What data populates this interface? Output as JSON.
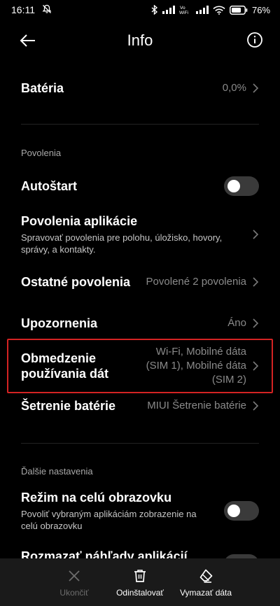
{
  "status_bar": {
    "time": "16:11",
    "battery": "76",
    "network_label": "Vo WiFi"
  },
  "header": {
    "title": "Info"
  },
  "battery_row": {
    "label": "Batéria",
    "value": "0,0%"
  },
  "permissions_section": {
    "title": "Povolenia",
    "autostart": {
      "label": "Autoštart",
      "enabled": false
    },
    "app_permissions": {
      "label": "Povolenia aplikácie",
      "description": "Spravovať povolenia pre polohu, úložisko, hovory, správy, a kontakty."
    },
    "other_permissions": {
      "label": "Ostatné povolenia",
      "value": "Povolené 2 povolenia"
    },
    "notifications": {
      "label": "Upozornenia",
      "value": "Áno"
    },
    "data_usage_restriction": {
      "label": "Obmedzenie používania dát",
      "value": "Wi-Fi, Mobilné dáta (SIM 1), Mobilné dáta (SIM 2)"
    },
    "battery_saver": {
      "label": "Šetrenie batérie",
      "value": "MIUI Šetrenie batérie"
    }
  },
  "additional_section": {
    "title": "Ďalšie nastavenia",
    "fullscreen_mode": {
      "label": "Režim na celú obrazovku",
      "description": "Povoliť vybraným aplikáciám zobrazenie na celú obrazovku",
      "enabled": false
    },
    "blur_previews": {
      "label": "Rozmazať náhľady aplikácií"
    }
  },
  "bottom_actions": {
    "end": "Ukončiť",
    "uninstall": "Odinštalovať",
    "clear_data": "Vymazať dáta"
  },
  "colors": {
    "background": "#000000",
    "highlight_border": "#d42323",
    "secondary_text": "#8a8a8a",
    "toggle_off": "#3a3a3a"
  }
}
